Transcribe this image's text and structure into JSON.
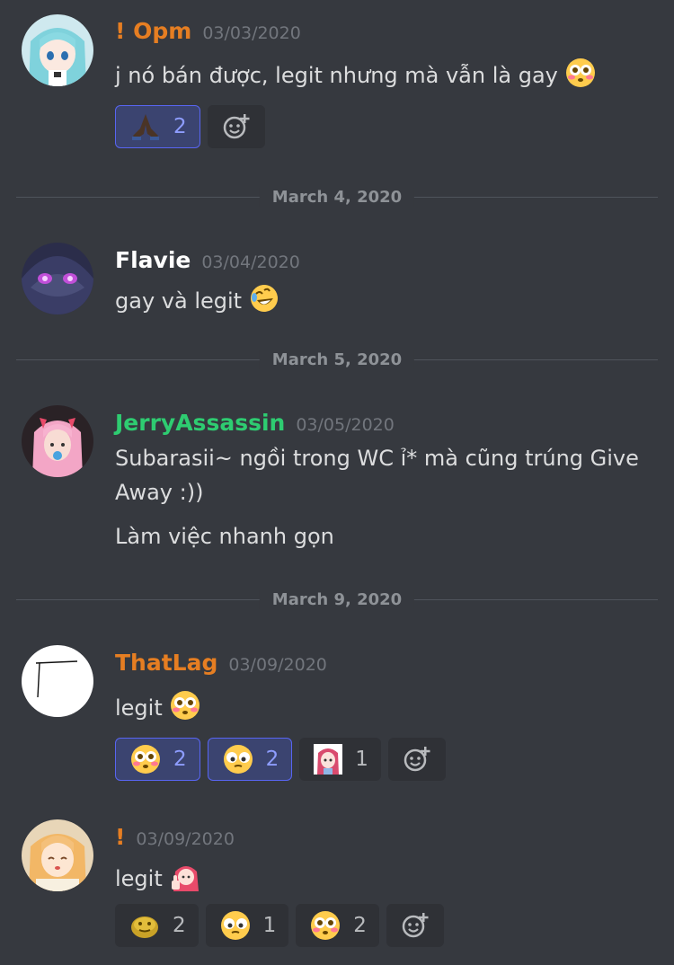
{
  "colors": {
    "background": "#36393f",
    "orange": "#e67e22",
    "white": "#ffffff",
    "green": "#2ecc71",
    "reaction_active": "#5865f2"
  },
  "dividers": [
    "March 4, 2020",
    "March 5, 2020",
    "March 9, 2020"
  ],
  "messages": [
    {
      "username": "! Opm",
      "timestamp": "03/03/2020",
      "lines": [
        "j nó bán được, legit nhưng mà vẫn là gay"
      ],
      "reactions": [
        {
          "icon": "pray-icon",
          "count": "2",
          "active": true
        }
      ]
    },
    {
      "username": "Flavie",
      "timestamp": "03/04/2020",
      "lines": [
        "gay và legit"
      ],
      "reactions": []
    },
    {
      "username": "JerryAssassin",
      "timestamp": "03/05/2020",
      "lines": [
        "Subarasii~ ngồi trong WC ỉ* mà cũng trúng Give",
        "Away :))",
        "Làm việc nhanh gọn"
      ],
      "reactions": []
    },
    {
      "username": "ThatLag",
      "timestamp": "03/09/2020",
      "lines": [
        "legit"
      ],
      "reactions": [
        {
          "icon": "flushed-face-icon",
          "count": "2",
          "active": true
        },
        {
          "icon": "dizzy-face-icon",
          "count": "2",
          "active": true
        },
        {
          "icon": "anime-girl-sticker-icon",
          "count": "1",
          "active": false
        }
      ]
    },
    {
      "username": "!",
      "timestamp": "03/09/2020",
      "lines": [
        "legit"
      ],
      "reactions": [
        {
          "icon": "gold-blob-icon",
          "count": "2",
          "active": false
        },
        {
          "icon": "dizzy-face-icon",
          "count": "1",
          "active": false
        },
        {
          "icon": "flushed-face-icon",
          "count": "2",
          "active": false
        }
      ]
    }
  ]
}
